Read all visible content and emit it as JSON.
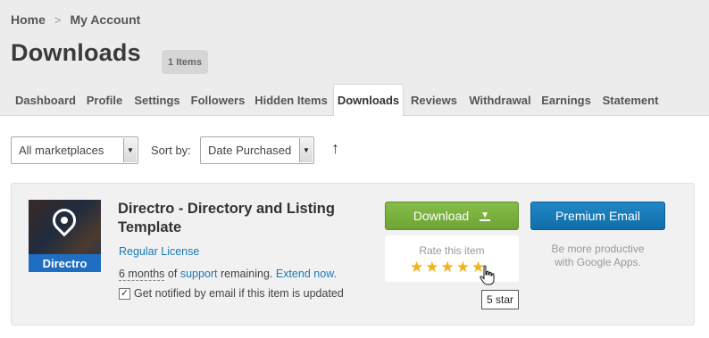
{
  "breadcrumb": {
    "home": "Home",
    "separator": ">",
    "current": "My Account"
  },
  "page": {
    "title": "Downloads",
    "count_badge": "1 Items"
  },
  "tabs": [
    {
      "label": "Dashboard",
      "active": false
    },
    {
      "label": "Profile",
      "active": false
    },
    {
      "label": "Settings",
      "active": false
    },
    {
      "label": "Followers",
      "active": false
    },
    {
      "label": "Hidden Items",
      "active": false
    },
    {
      "label": "Downloads",
      "active": true
    },
    {
      "label": "Reviews",
      "active": false
    },
    {
      "label": "Withdrawal",
      "active": false
    },
    {
      "label": "Earnings",
      "active": false
    },
    {
      "label": "Statement",
      "active": false
    }
  ],
  "filters": {
    "marketplace_value": "All marketplaces",
    "sort_label": "Sort by:",
    "sort_value": "Date Purchased",
    "sort_direction_icon": "↑"
  },
  "item": {
    "thumb_label": "Directro",
    "title": "Directro - Directory and Listing Template",
    "license": "Regular License",
    "support": {
      "months": "6 months",
      "of": "of",
      "support_link": "support",
      "remaining": "remaining.",
      "extend_link": "Extend now."
    },
    "notify_label": "Get notified by email if this item is updated",
    "notify_checked": true,
    "download_label": "Download",
    "rate_label": "Rate this item",
    "rating": 5,
    "rating_max": 5,
    "star_glyph": "★",
    "premium_label": "Premium Email",
    "premium_note_line1": "Be more productive",
    "premium_note_line2": "with Google Apps."
  },
  "tooltip": "5 star",
  "colors": {
    "download_green": "#7ab23e",
    "premium_blue": "#1a7ab8",
    "star_gold": "#f0b21b",
    "thumb_label_blue": "#1f6ec1"
  }
}
